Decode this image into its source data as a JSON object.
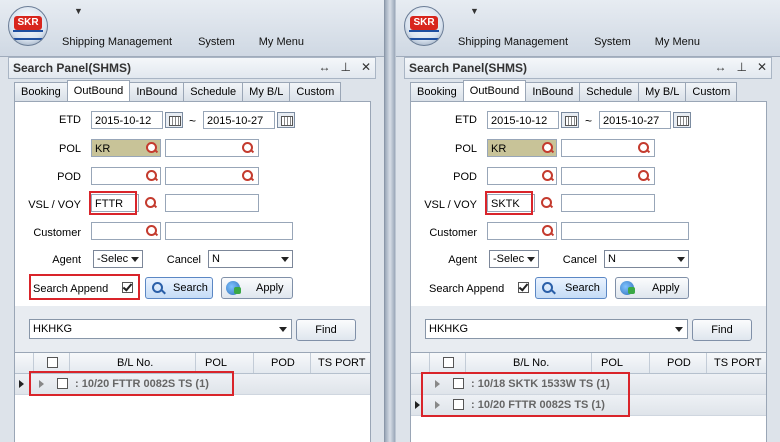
{
  "app": {
    "logo_text": "SKR",
    "qat_glyph": "▼",
    "menu": [
      "Shipping Management",
      "System",
      "My Menu"
    ]
  },
  "panel": {
    "title": "Search Panel(SHMS)",
    "icons": [
      "↔",
      "⊥",
      "✕"
    ],
    "tabs": [
      "Booking",
      "OutBound",
      "InBound",
      "Schedule",
      "My B/L",
      "Custom"
    ],
    "active_tab": "OutBound"
  },
  "form": {
    "etd_label": "ETD",
    "etd_from": "2015-10-12",
    "etd_to": "2015-10-27",
    "tilde": "~",
    "pol_label": "POL",
    "pol_value": "KR",
    "pod_label": "POD",
    "vsl_label": "VSL / VOY",
    "customer_label": "Customer",
    "agent_label": "Agent",
    "agent_value": "-Selec",
    "cancel_label": "Cancel",
    "cancel_value": "N",
    "search_append_label": "Search Append",
    "search_btn": "Search",
    "apply_btn": "Apply"
  },
  "lower": {
    "port_value": "HKHKG",
    "find_btn": "Find",
    "columns": [
      "B/L No.",
      "POL",
      "POD",
      "TS PORT"
    ]
  },
  "left": {
    "vsl_value": "FTTR",
    "groups": [
      ": 10/20 FTTR 0082S TS (1)"
    ]
  },
  "right": {
    "vsl_value": "SKTK",
    "groups": [
      ": 10/18 SKTK 1533W TS (1)",
      ": 10/20 FTTR 0082S TS (1)"
    ]
  },
  "colors": {
    "highlight_field": "#c8c398",
    "annotation_red": "#d9242a"
  }
}
